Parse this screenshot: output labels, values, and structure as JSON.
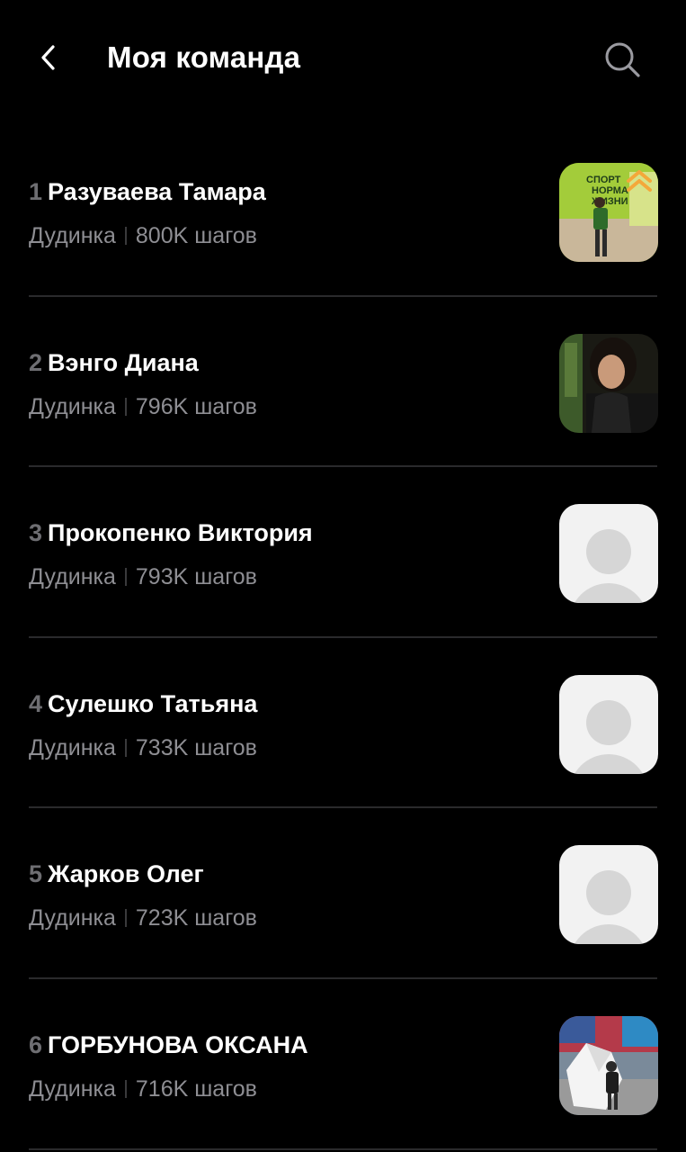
{
  "header": {
    "title": "Моя команда",
    "back_icon": "chevron-left-icon",
    "search_icon": "search-icon"
  },
  "members": [
    {
      "rank": "1",
      "name": "Разуваева Тамара",
      "city": "Дудинка",
      "steps": "800K шагов",
      "avatar": "photo-1"
    },
    {
      "rank": "2",
      "name": "Вэнго Диана",
      "city": "Дудинка",
      "steps": "796K шагов",
      "avatar": "photo-2"
    },
    {
      "rank": "3",
      "name": "Прокопенко Виктория",
      "city": "Дудинка",
      "steps": "793K шагов",
      "avatar": "placeholder"
    },
    {
      "rank": "4",
      "name": "Сулешко Татьяна",
      "city": "Дудинка",
      "steps": "733K шагов",
      "avatar": "placeholder"
    },
    {
      "rank": "5",
      "name": "Жарков Олег",
      "city": "Дудинка",
      "steps": "723K шагов",
      "avatar": "placeholder"
    },
    {
      "rank": "6",
      "name": "ГОРБУНОВА ОКСАНА",
      "city": "Дудинка",
      "steps": "716K шагов",
      "avatar": "photo-3"
    }
  ],
  "photo_text": {
    "banner": "СПОРТ НОРМА ЖИЗНИ"
  },
  "colors": {
    "background": "#000000",
    "text_primary": "#ffffff",
    "text_secondary": "#8e8e93",
    "rank": "#6e6e72",
    "divider": "#2a2a2c",
    "placeholder_bg": "#f2f2f2",
    "placeholder_fg": "#d6d6d6",
    "rank_up_badge": "#f4a83a"
  }
}
